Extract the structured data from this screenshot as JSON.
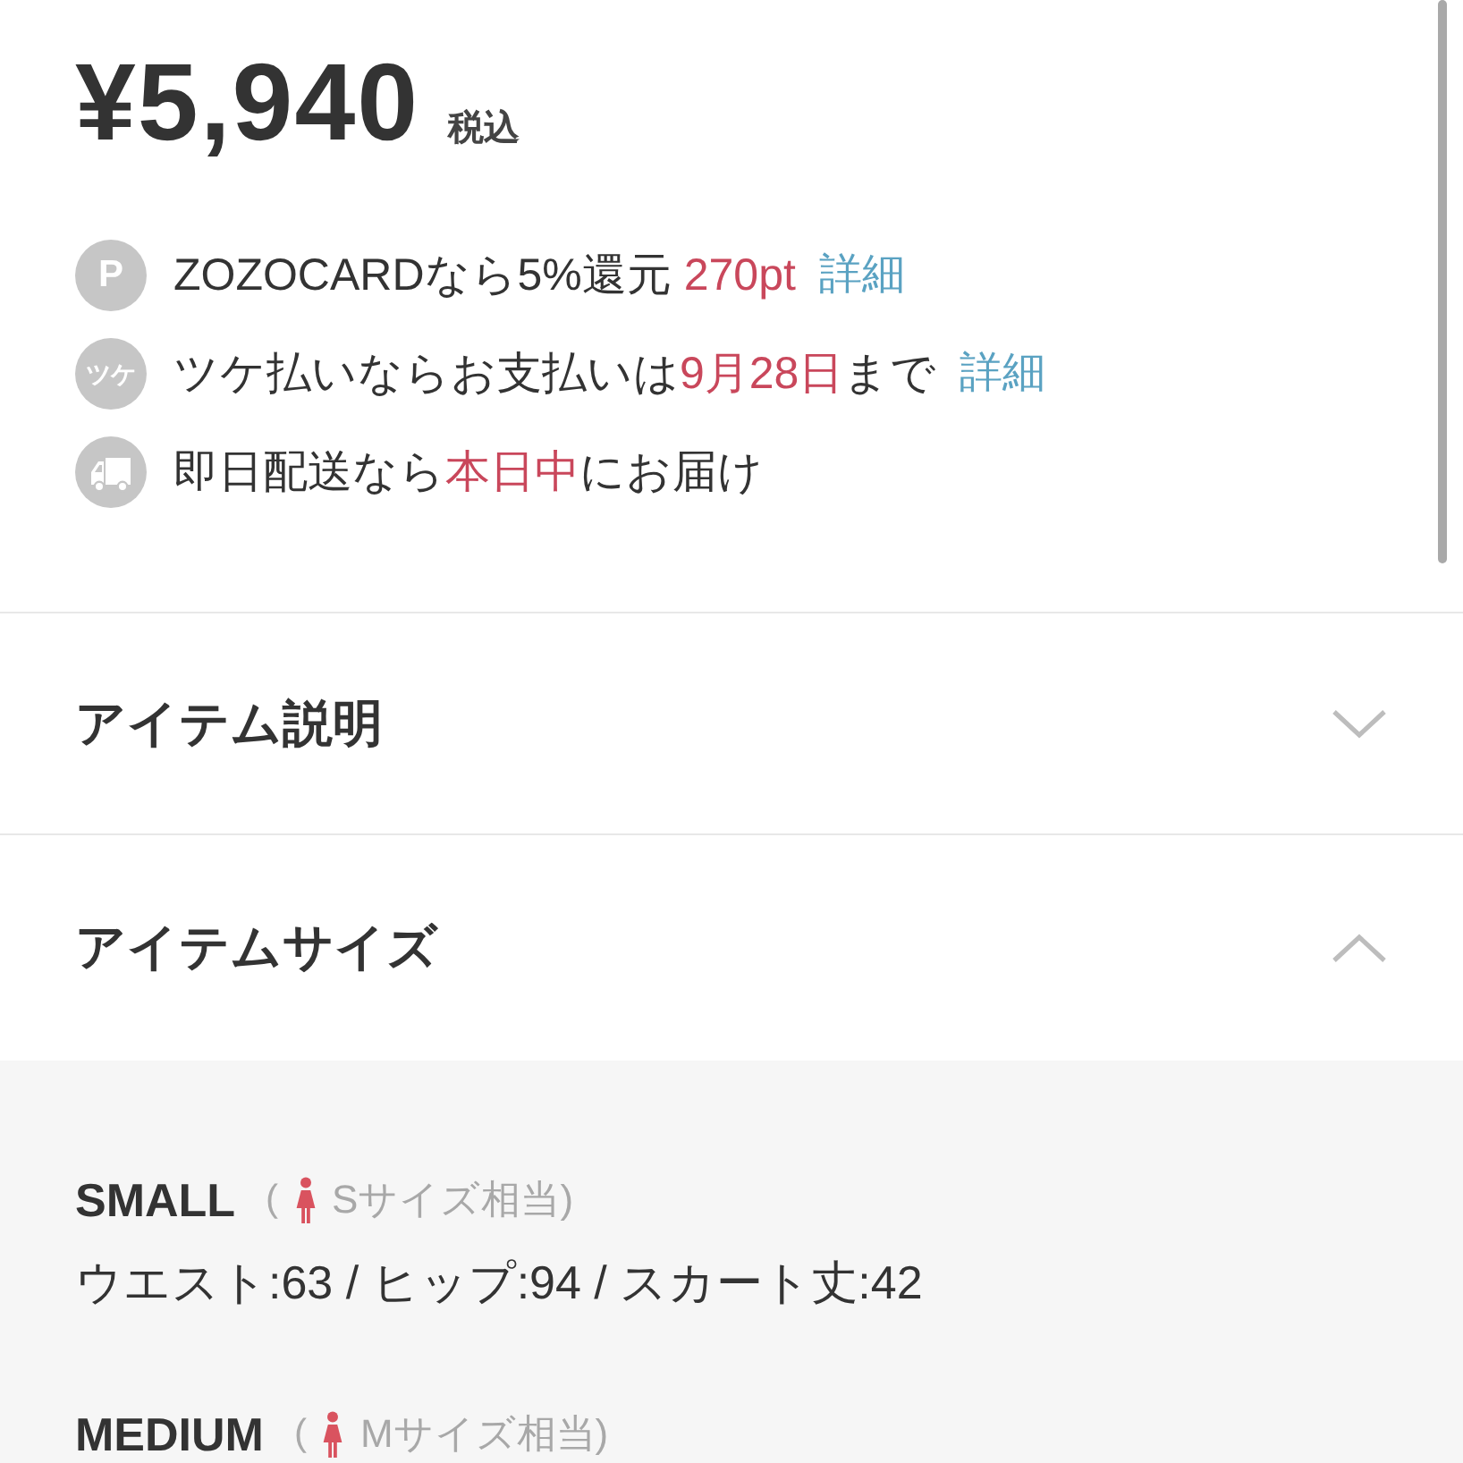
{
  "price": {
    "amount": "¥5,940",
    "tax_note": "税込"
  },
  "benefits": [
    {
      "icon": {
        "kind": "label",
        "label": "P"
      },
      "segments": [
        {
          "text": "ZOZOCARDなら5%還元 ",
          "highlight": false
        },
        {
          "text": "270pt",
          "highlight": true
        }
      ],
      "link": "詳細"
    },
    {
      "icon": {
        "kind": "label",
        "label": "ツケ"
      },
      "segments": [
        {
          "text": "ツケ払いならお支払いは",
          "highlight": false
        },
        {
          "text": "9月28日",
          "highlight": true
        },
        {
          "text": "まで",
          "highlight": false
        }
      ],
      "link": "詳細"
    },
    {
      "icon": {
        "kind": "truck"
      },
      "segments": [
        {
          "text": "即日配送なら",
          "highlight": false
        },
        {
          "text": "本日中",
          "highlight": true
        },
        {
          "text": "にお届け",
          "highlight": false
        }
      ]
    }
  ],
  "sections": [
    {
      "title": "アイテム説明",
      "expanded": false
    },
    {
      "title": "アイテムサイズ",
      "expanded": true,
      "sizes": [
        {
          "name": "SMALL",
          "equivalent_open": "(",
          "equivalent": "Sサイズ相当)",
          "measurements": "ウエスト:63 / ヒップ:94 / スカート丈:42"
        },
        {
          "name": "MEDIUM",
          "equivalent_open": "(",
          "equivalent": "Mサイズ相当)"
        }
      ]
    }
  ]
}
